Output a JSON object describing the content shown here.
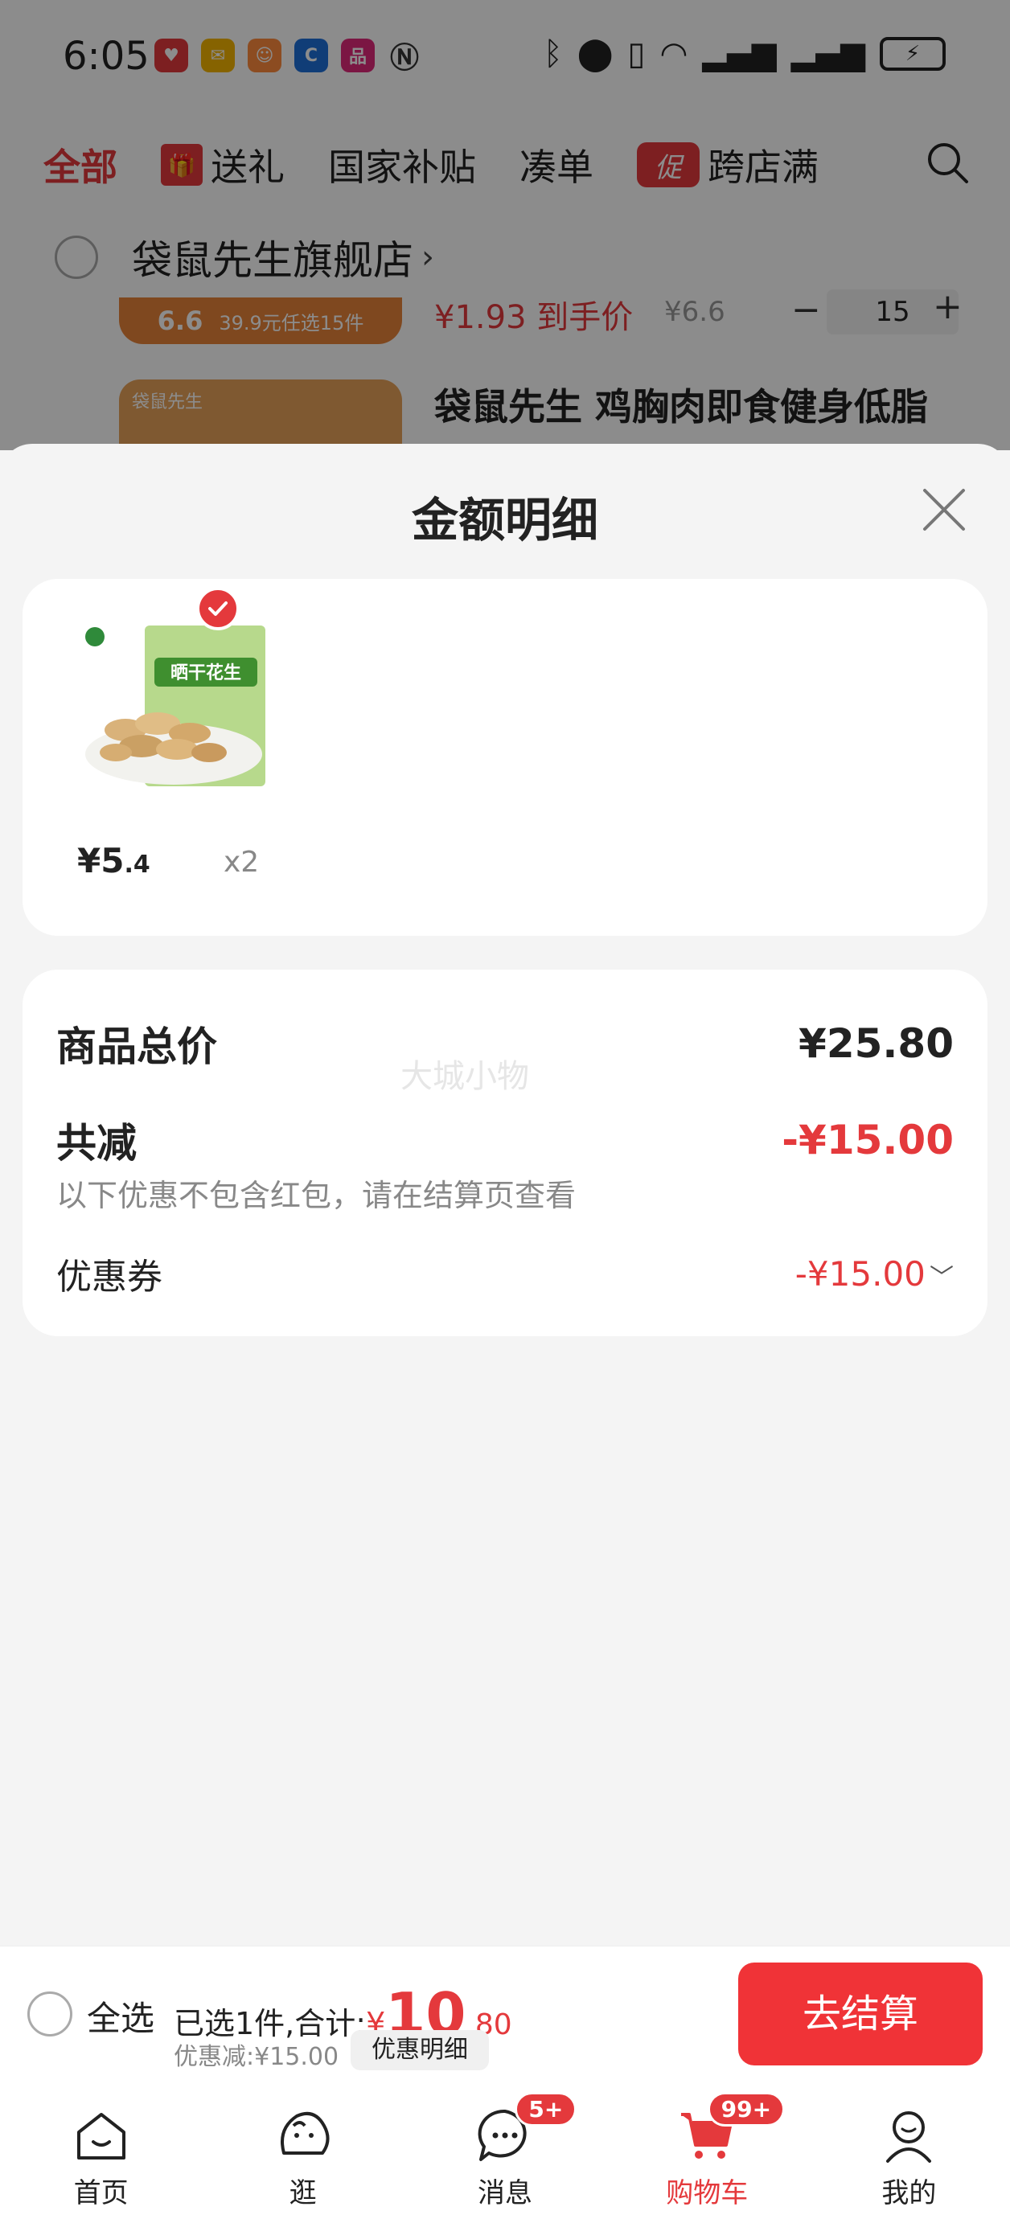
{
  "status_bar": {
    "time": "6:05",
    "apps": [
      {
        "icon": "heart-app-icon",
        "color": "#e4393c"
      },
      {
        "icon": "mail-app-icon",
        "color": "#f4b400"
      },
      {
        "icon": "mascot-app-icon",
        "color": "#ff8a3d"
      },
      {
        "icon": "c-app-icon",
        "color": "#1e6fd9"
      },
      {
        "icon": "brand-app-icon",
        "color": "#e0287a"
      }
    ],
    "battery_glyph": "⚡"
  },
  "top_tabs": {
    "all": "全部",
    "gift": "送礼",
    "subsidy": "国家补贴",
    "bundle": "凑单",
    "promo_badge": "促",
    "cross_store": "跨店满"
  },
  "store": {
    "name": "袋鼠先生旗舰店",
    "chevron": "›"
  },
  "bg_product1": {
    "thumb_text_1": "6.6",
    "thumb_text_2": "39.9元任选15件",
    "price": "¥1.93 到手价",
    "original_price": "¥6.6",
    "minus": "−",
    "qty": "15",
    "plus": "+"
  },
  "bg_product2": {
    "thumb_text": "袋鼠先生",
    "title": "袋鼠先生 鸡胸肉即食健身低脂"
  },
  "sheet": {
    "title": "金额明细",
    "item": {
      "price_int": "¥5",
      "price_dec": ".4",
      "qty": "x2"
    },
    "summary": {
      "total_label": "商品总价",
      "total_value": "¥25.80",
      "reduce_label": "共减",
      "reduce_value": "-¥15.00",
      "note": "以下优惠不包含红包，请在结算页查看",
      "coupon_label": "优惠券",
      "coupon_value": "-¥15.00",
      "coupon_chevron": "﹀",
      "watermark": "大城小物"
    }
  },
  "checkout_bar": {
    "select_all": "全选",
    "selected_text": "已选1件,合计:",
    "currency": "¥",
    "total_int": "10",
    "total_dec": ".80",
    "discount_text": "优惠减:¥15.00",
    "detail_button": "优惠明细",
    "checkout_button": "去结算"
  },
  "nav": {
    "items": [
      {
        "label": "首页",
        "icon": "home-icon"
      },
      {
        "label": "逛",
        "icon": "browse-icon"
      },
      {
        "label": "消息",
        "icon": "message-icon",
        "badge": "5+"
      },
      {
        "label": "购物车",
        "icon": "cart-icon",
        "badge": "99+"
      },
      {
        "label": "我的",
        "icon": "profile-icon"
      }
    ]
  },
  "colors": {
    "accent": "#e4393c",
    "checkout": "#f03337"
  }
}
